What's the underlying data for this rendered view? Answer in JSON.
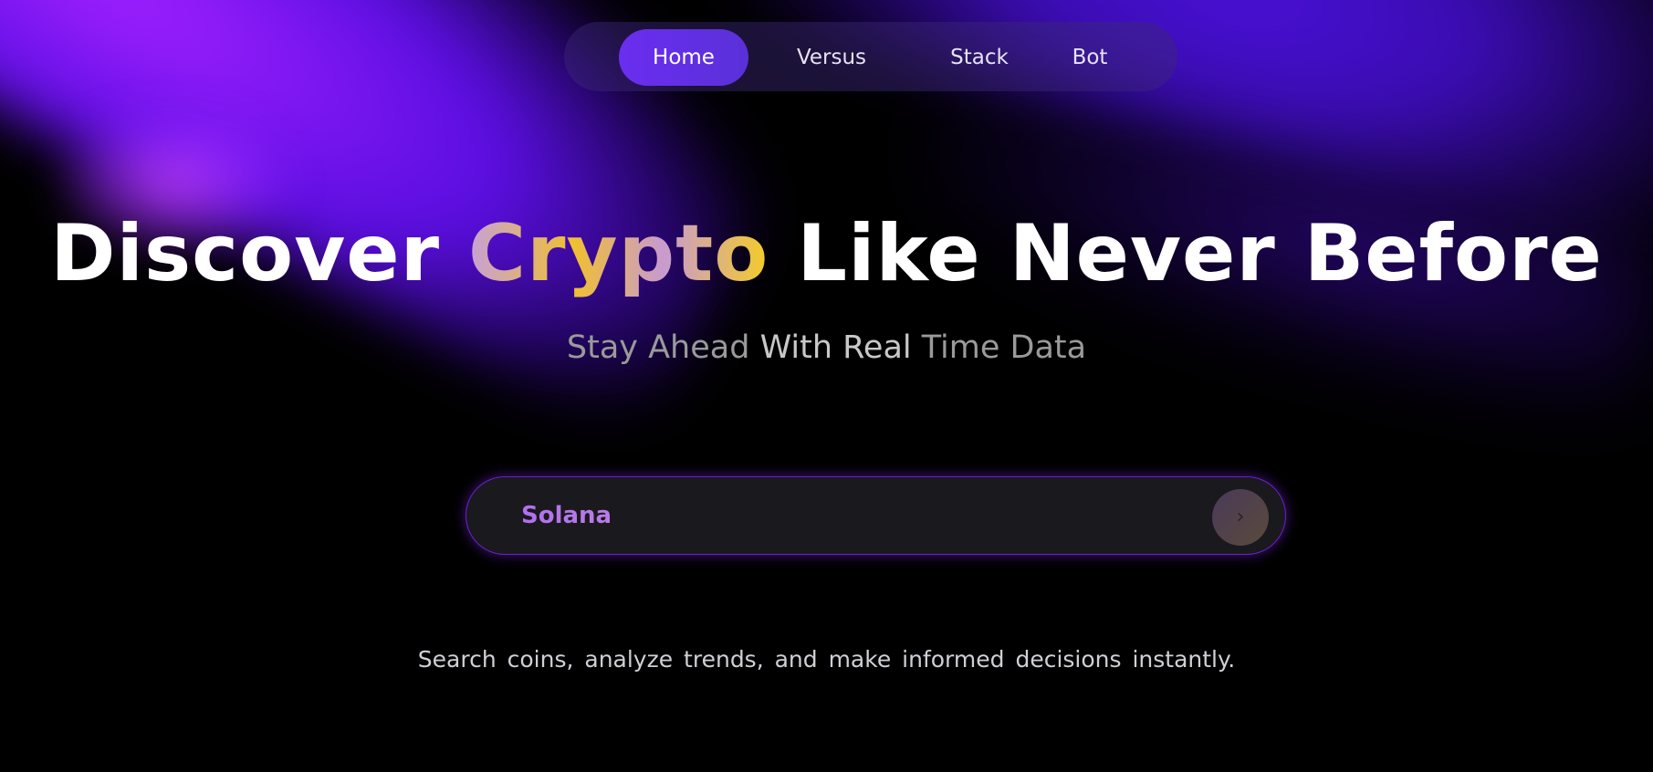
{
  "nav": {
    "items": [
      {
        "label": "Home",
        "active": true
      },
      {
        "label": "Versus",
        "active": false
      },
      {
        "label": "Stack",
        "active": false
      },
      {
        "label": "Bot",
        "active": false
      }
    ]
  },
  "hero": {
    "title_part1": "Discover ",
    "title_highlight": "Crypto",
    "title_part2": " Like Never Before",
    "subtitle_part1": "Stay Ahead ",
    "subtitle_emphasis": "With Real",
    "subtitle_part2": " Time Data"
  },
  "search": {
    "value": "Solana",
    "go_icon": "chevron-right-icon",
    "go_glyph": "›"
  },
  "tagline": "Search coins, analyze trends, and make informed decisions instantly.",
  "colors": {
    "background": "#000000",
    "accent_purple": "#6a2ef0",
    "highlight_gold": "#f0c030",
    "search_border": "#6d1fd0"
  }
}
